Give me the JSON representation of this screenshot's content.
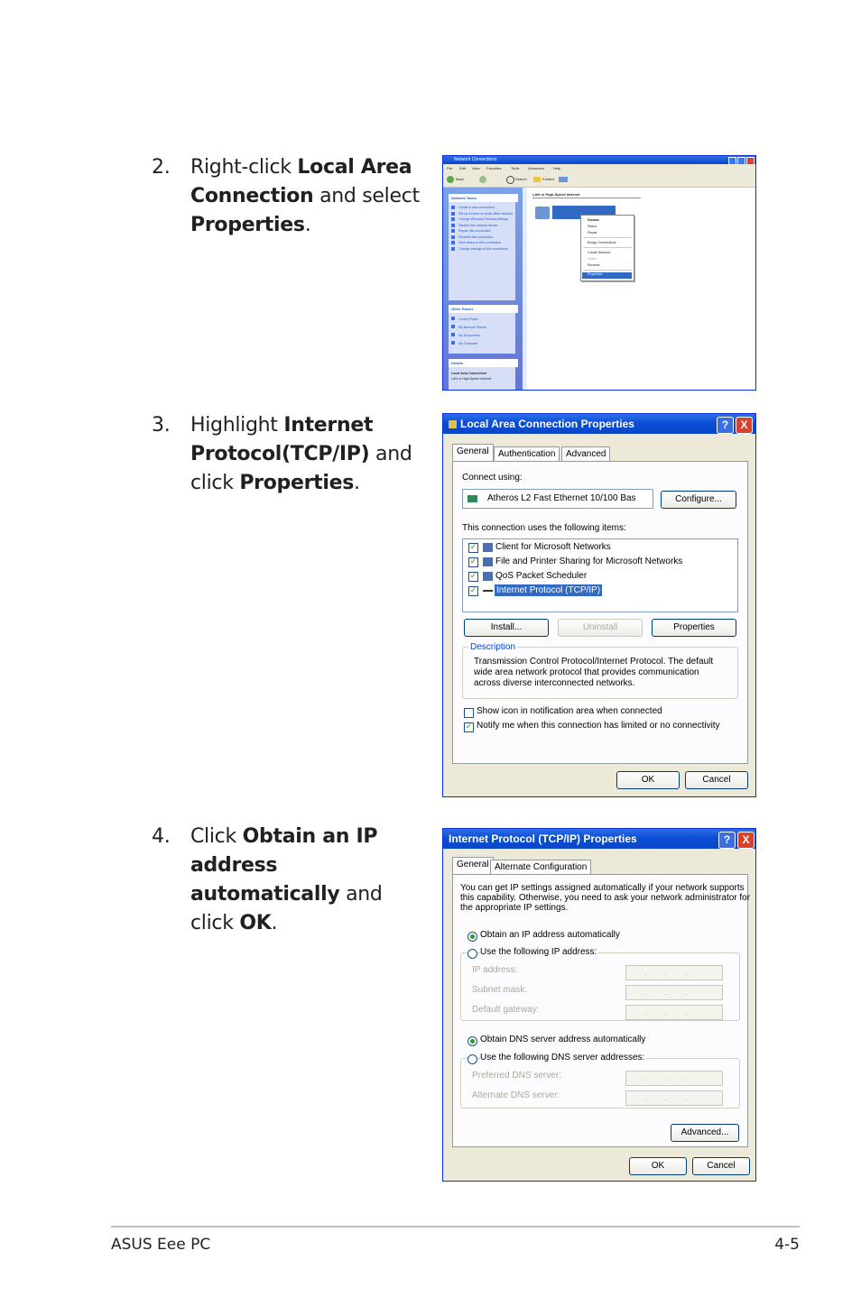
{
  "steps": [
    {
      "number": "2.",
      "parts": [
        "Right-click ",
        "Local Area Connection",
        " and select ",
        "Properties",
        "."
      ]
    },
    {
      "number": "3.",
      "parts": [
        "Highlight ",
        "Internet Protocol(TCP/IP)",
        " and click ",
        "Properties",
        "."
      ]
    },
    {
      "number": "4.",
      "parts": [
        "Click ",
        "Obtain an IP address automatically",
        " and click ",
        "OK",
        "."
      ]
    }
  ],
  "screenshot1": {
    "title": "Network Connections",
    "menu": [
      "File",
      "Edit",
      "View",
      "Favorites",
      "Tools",
      "Advanced",
      "Help"
    ],
    "toolbar": [
      "Back",
      "Search",
      "Folders"
    ],
    "section_header": "LAN or High-Speed Internet",
    "network_tasks_title": "Network Tasks",
    "network_tasks": [
      "Create a new connection",
      "Set up a home or small office network",
      "Change Windows Firewall settings",
      "Disable this network device",
      "Repair this connection",
      "Rename this connection",
      "View status of this connection",
      "Change settings of this connection"
    ],
    "other_places_title": "Other Places",
    "other_places": [
      "Control Panel",
      "My Network Places",
      "My Documents",
      "My Computer"
    ],
    "details_title": "Details",
    "details": [
      "Local Area Connection",
      "LAN or High-Speed Internet"
    ],
    "context_menu": [
      "Disable",
      "Status",
      "Repair",
      "Bridge Connections",
      "Create Shortcut",
      "Delete",
      "Rename",
      "Properties"
    ]
  },
  "dialog1": {
    "title": "Local Area Connection Properties",
    "help": "?",
    "close": "X",
    "tabs": [
      "General",
      "Authentication",
      "Advanced"
    ],
    "connect_using_label": "Connect using:",
    "adapter": "Atheros L2 Fast Ethernet 10/100 Bas",
    "configure_button": "Configure...",
    "items_label": "This connection uses the following items:",
    "items": [
      "Client for Microsoft Networks",
      "File and Printer Sharing for Microsoft Networks",
      "QoS Packet Scheduler",
      "Internet Protocol (TCP/IP)"
    ],
    "install_button": "Install...",
    "uninstall_button": "Uninstall",
    "properties_button": "Properties",
    "description_title": "Description",
    "description_lines": [
      "Transmission Control Protocol/Internet Protocol. The default",
      "wide area network protocol that provides communication",
      "across diverse interconnected networks."
    ],
    "show_icon_label": "Show icon in notification area when connected",
    "notify_label": "Notify me when this connection has limited or no connectivity",
    "ok_button": "OK",
    "cancel_button": "Cancel"
  },
  "dialog2": {
    "title": "Internet Protocol (TCP/IP) Properties",
    "help": "?",
    "close": "X",
    "tabs": [
      "General",
      "Alternate Configuration"
    ],
    "intro_lines": [
      "You can get IP settings assigned automatically if your network supports",
      "this capability. Otherwise, you need to ask your network administrator for",
      "the appropriate IP settings."
    ],
    "obtain_ip_label": "Obtain an IP address automatically",
    "use_ip_label": "Use the following IP address:",
    "ip_address_label": "IP address:",
    "subnet_mask_label": "Subnet mask:",
    "default_gateway_label": "Default gateway:",
    "obtain_dns_label": "Obtain DNS server address automatically",
    "use_dns_label": "Use the following DNS server addresses:",
    "preferred_dns_label": "Preferred DNS server:",
    "alternate_dns_label": "Alternate DNS server:",
    "ip_placeholder": "...",
    "advanced_button": "Advanced...",
    "ok_button": "OK",
    "cancel_button": "Cancel"
  },
  "footer": {
    "left": "ASUS Eee PC",
    "right": "4-5"
  },
  "colors": {
    "xp_blue": "#0a4ed6",
    "panel_bg": "#ece9d8",
    "accent_green": "#21a121",
    "highlight": "#316ac5"
  }
}
